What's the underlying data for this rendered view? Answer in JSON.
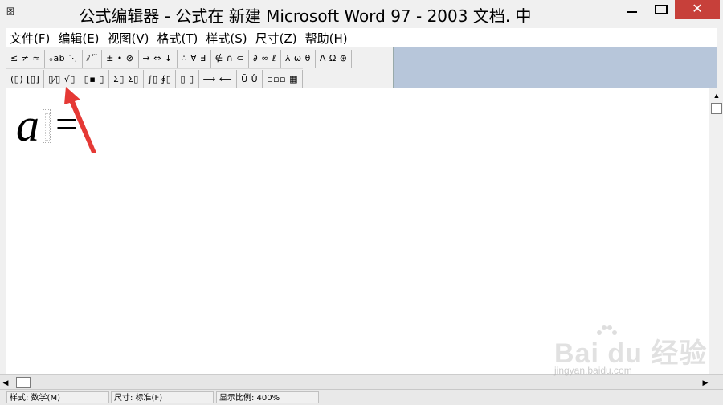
{
  "window": {
    "icon": "图",
    "title": "公式编辑器 - 公式在 新建 Microsoft Word 97 - 2003 文档. 中",
    "close_glyph": "✕"
  },
  "menu": {
    "items": [
      {
        "label": "文件(F)"
      },
      {
        "label": "编辑(E)"
      },
      {
        "label": "视图(V)"
      },
      {
        "label": "格式(T)"
      },
      {
        "label": "样式(S)"
      },
      {
        "label": "尺寸(Z)"
      },
      {
        "label": "帮助(H)"
      }
    ]
  },
  "toolbar": {
    "row1": [
      {
        "label": "≤ ≠ ≈",
        "icon": "relational-symbols-icon"
      },
      {
        "label": "⫰ab ⋱",
        "icon": "spaces-ellipses-icon"
      },
      {
        "label": "⫽ ⃗ ⃛",
        "icon": "embellishments-icon"
      },
      {
        "label": "± • ⊗",
        "icon": "operator-symbols-icon"
      },
      {
        "label": "→ ⇔ ↓",
        "icon": "arrow-symbols-icon"
      },
      {
        "label": "∴ ∀ ∃",
        "icon": "logical-symbols-icon"
      },
      {
        "label": "∉ ∩ ⊂",
        "icon": "set-theory-symbols-icon"
      },
      {
        "label": "∂ ∞ ℓ",
        "icon": "misc-symbols-icon"
      },
      {
        "label": "λ ω θ",
        "icon": "greek-lowercase-icon"
      },
      {
        "label": "Λ Ω ⊛",
        "icon": "greek-uppercase-icon"
      }
    ],
    "row2": [
      {
        "label": "(▯) [▯]",
        "icon": "fence-templates-icon"
      },
      {
        "label": "▯⁄▯ √▯",
        "icon": "fraction-radical-templates-icon"
      },
      {
        "label": "▯▪ ▯̲",
        "icon": "subscript-superscript-templates-icon"
      },
      {
        "label": "Σ▯ Σ▯",
        "icon": "summation-templates-icon"
      },
      {
        "label": "∫▯ ∮▯",
        "icon": "integral-templates-icon"
      },
      {
        "label": "▯̄ ▯",
        "icon": "underbar-overbar-templates-icon"
      },
      {
        "label": "⟶ ⟵",
        "icon": "labeled-arrow-templates-icon"
      },
      {
        "label": "Ū Ů",
        "icon": "products-set-theory-templates-icon"
      },
      {
        "label": "▫▫▫ ▦",
        "icon": "matrix-templates-icon"
      }
    ]
  },
  "document": {
    "variable": "a",
    "operator": "="
  },
  "scrollbars": {
    "up_glyph": "▲",
    "left_glyph": "◀",
    "right_glyph": "▶"
  },
  "status": {
    "style": "样式: 数学(M)",
    "size": "尺寸: 标准(F)",
    "zoom": "显示比例: 400%"
  },
  "watermark": {
    "logo": "Bai du 经验",
    "url": "jingyan.baidu.com"
  },
  "colors": {
    "close_button": "#c7403a",
    "annotation_arrow": "#e53935",
    "toolbar_backdrop": "#b7c6da"
  }
}
